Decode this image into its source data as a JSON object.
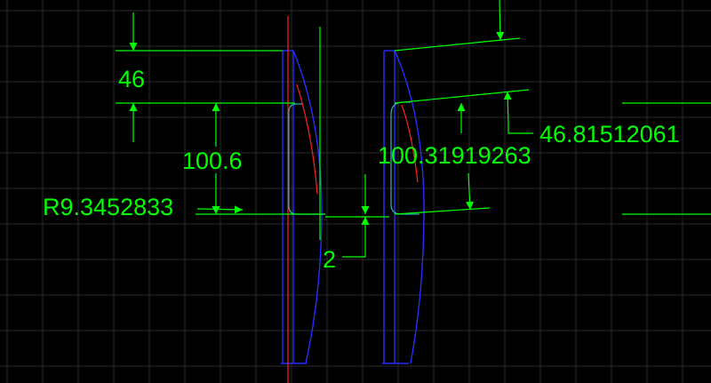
{
  "colors": {
    "background": "#000000",
    "grid": "#3a3a3a",
    "dimension": "#00ff00",
    "profile": "#2b2bff",
    "axis": "#ff2020",
    "fillet": "#2bb0b0"
  },
  "dimensions": {
    "top_height": "46",
    "left_height": "100.6",
    "fillet_radius": "R9.3452833",
    "gap": "2",
    "right_height": "100.31919263",
    "right_top_height": "46.81512061"
  }
}
